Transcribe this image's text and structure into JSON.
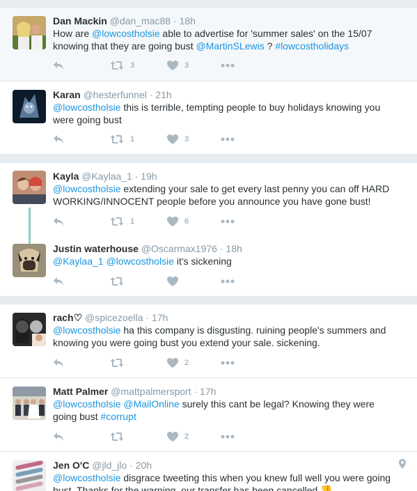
{
  "colors": {
    "link": "#1b95e0",
    "name": "#292f33",
    "meta": "#8899a6",
    "background": "#e6ecf0",
    "thread_line": "#8fd0c8"
  },
  "icons": {
    "reply": "reply-icon",
    "retweet": "retweet-icon",
    "like": "heart-icon",
    "more": "more-dots-icon",
    "location": "location-pin-icon"
  },
  "tweets": [
    {
      "name": "Dan Mackin",
      "handle": "@dan_mac88",
      "time": "· 18h",
      "text": [
        {
          "t": "How are ",
          "link": false
        },
        {
          "t": "@lowcostholsie",
          "link": true
        },
        {
          "t": " able to advertise for 'summer sales' on the 15/07 knowing that they are going bust ",
          "link": false
        },
        {
          "t": "@MartinSLewis",
          "link": true
        },
        {
          "t": " ? ",
          "link": false
        },
        {
          "t": "#lowcostholidays",
          "link": true
        }
      ],
      "retweets": "3",
      "likes": "3"
    },
    {
      "name": "Karan",
      "handle": "@hesterfunnel",
      "time": "· 21h",
      "text": [
        {
          "t": "@lowcostholsie",
          "link": true
        },
        {
          "t": " this is terrible, tempting people to buy holidays knowing you were going bust",
          "link": false
        }
      ],
      "retweets": "1",
      "likes": "3"
    },
    {
      "name": "Kayla",
      "handle": "@Kaylaa_1",
      "time": "· 19h",
      "text": [
        {
          "t": "@lowcostholsie",
          "link": true
        },
        {
          "t": " extending your sale to get every last penny you can off HARD WORKING/INNOCENT people before you announce you have gone bust!",
          "link": false
        }
      ],
      "retweets": "1",
      "likes": "6"
    },
    {
      "name": "Justin waterhouse",
      "handle": "@Oscarmax1976",
      "time": "· 18h",
      "text": [
        {
          "t": "@Kaylaa_1",
          "link": true
        },
        {
          "t": " ",
          "link": false
        },
        {
          "t": "@lowcostholsie",
          "link": true
        },
        {
          "t": " it's sickening",
          "link": false
        }
      ],
      "retweets": "",
      "likes": ""
    },
    {
      "name": "rach♡",
      "handle": "@spicezoella",
      "time": "· 17h",
      "text": [
        {
          "t": "@lowcostholsie",
          "link": true
        },
        {
          "t": " ha this company is disgusting. ruining people's summers and knowing you were going bust you extend your sale. sickening.",
          "link": false
        }
      ],
      "retweets": "",
      "likes": "2"
    },
    {
      "name": "Matt Palmer",
      "handle": "@mattpalmersport",
      "time": "· 17h",
      "text": [
        {
          "t": "@lowcostholsie",
          "link": true
        },
        {
          "t": " ",
          "link": false
        },
        {
          "t": "@MailOnline",
          "link": true
        },
        {
          "t": " surely this cant be legal? Knowing they were going bust ",
          "link": false
        },
        {
          "t": "#corrupt",
          "link": true
        }
      ],
      "retweets": "",
      "likes": "2"
    },
    {
      "name": "Jen O'C",
      "handle": "@jld_jlo",
      "time": "· 20h",
      "text": [
        {
          "t": "@lowcostholsie",
          "link": true
        },
        {
          "t": " disgrace tweeting this when you knew full well you were going bust. Thanks for the warning, our transfer has been cancelled 👎",
          "link": false
        }
      ],
      "retweets": "",
      "likes": ""
    }
  ]
}
